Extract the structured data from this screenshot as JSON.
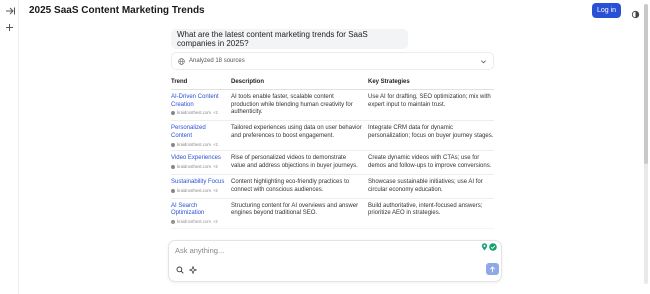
{
  "header": {
    "title": "2025 SaaS Content Marketing Trends",
    "login_label": "Log in"
  },
  "sidebar": {
    "icons": [
      "expand-arrow-icon",
      "plus-icon"
    ]
  },
  "conversation": {
    "question": "What are the latest content marketing trends for SaaS companies in 2025?",
    "sources_label": "Analyzed 18 sources"
  },
  "table": {
    "headers": [
      "Trend",
      "Description",
      "Key Strategies"
    ],
    "rows": [
      {
        "trend": "AI-Driven Content Creation",
        "source": "kraidrosthest.com",
        "source_count": "+2",
        "description": "AI tools enable faster, scalable content production while blending human creativity for authenticity.",
        "strategies": "Use AI for drafting, SEO optimization; mix with expert input to maintain trust."
      },
      {
        "trend": "Personalized Content",
        "source": "kraidrosthest.com",
        "source_count": "+2",
        "description": "Tailored experiences using data on user behavior and preferences to boost engagement.",
        "strategies": "Integrate CRM data for dynamic personalization; focus on buyer journey stages."
      },
      {
        "trend": "Video Experiences",
        "source": "kraidrosthest.com",
        "source_count": "+2",
        "description": "Rise of personalized videos to demonstrate value and address objections in buyer journeys.",
        "strategies": "Create dynamic videos with CTAs; use for demos and follow-ups to improve conversions."
      },
      {
        "trend": "Sustainability Focus",
        "source": "kraidrosthest.com",
        "source_count": "+2",
        "description": "Content highlighting eco-friendly practices to connect with conscious audiences.",
        "strategies": "Showcase sustainable initiatives; use AI for circular economy education."
      },
      {
        "trend": "AI Search Optimization",
        "source": "kraidrosthest.com",
        "source_count": "+2",
        "description": "Structuring content for AI overviews and answer engines beyond traditional SEO.",
        "strategies": "Build authoritative, intent-focused answers; prioritize AEO in strategies."
      }
    ]
  },
  "composer": {
    "placeholder": "Ask anything..."
  },
  "colors": {
    "accent": "#2a50d6",
    "send_button": "#8fa8e8",
    "question_bg": "#f3f4f6"
  }
}
